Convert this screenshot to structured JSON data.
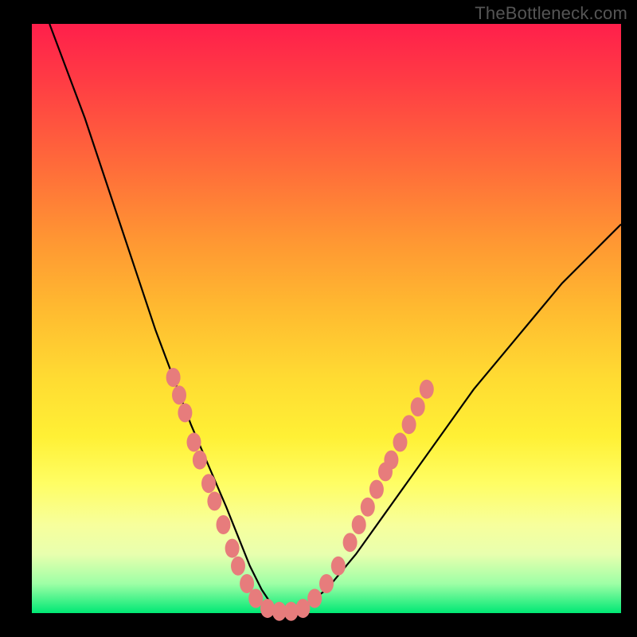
{
  "watermark": "TheBottleneck.com",
  "chart_data": {
    "type": "line",
    "title": "",
    "xlabel": "",
    "ylabel": "",
    "xlim": [
      0,
      100
    ],
    "ylim": [
      0,
      100
    ],
    "series": [
      {
        "name": "bottleneck-curve",
        "x": [
          3,
          6,
          9,
          12,
          15,
          18,
          21,
          24,
          27,
          30,
          33,
          35,
          37,
          39,
          41,
          43,
          46,
          50,
          55,
          60,
          65,
          70,
          75,
          80,
          85,
          90,
          95,
          100
        ],
        "y": [
          100,
          92,
          84,
          75,
          66,
          57,
          48,
          40,
          32,
          25,
          18,
          13,
          8,
          4,
          1,
          0,
          1,
          4,
          10,
          17,
          24,
          31,
          38,
          44,
          50,
          56,
          61,
          66
        ]
      }
    ],
    "markers": {
      "name": "highlight-dots",
      "color": "#e77c7c",
      "points": [
        {
          "x": 24,
          "y": 40
        },
        {
          "x": 25,
          "y": 37
        },
        {
          "x": 26,
          "y": 34
        },
        {
          "x": 27.5,
          "y": 29
        },
        {
          "x": 28.5,
          "y": 26
        },
        {
          "x": 30,
          "y": 22
        },
        {
          "x": 31,
          "y": 19
        },
        {
          "x": 32.5,
          "y": 15
        },
        {
          "x": 34,
          "y": 11
        },
        {
          "x": 35,
          "y": 8
        },
        {
          "x": 36.5,
          "y": 5
        },
        {
          "x": 38,
          "y": 2.5
        },
        {
          "x": 40,
          "y": 0.8
        },
        {
          "x": 42,
          "y": 0.3
        },
        {
          "x": 44,
          "y": 0.3
        },
        {
          "x": 46,
          "y": 0.8
        },
        {
          "x": 48,
          "y": 2.5
        },
        {
          "x": 50,
          "y": 5
        },
        {
          "x": 52,
          "y": 8
        },
        {
          "x": 54,
          "y": 12
        },
        {
          "x": 55.5,
          "y": 15
        },
        {
          "x": 57,
          "y": 18
        },
        {
          "x": 58.5,
          "y": 21
        },
        {
          "x": 60,
          "y": 24
        },
        {
          "x": 61,
          "y": 26
        },
        {
          "x": 62.5,
          "y": 29
        },
        {
          "x": 64,
          "y": 32
        },
        {
          "x": 65.5,
          "y": 35
        },
        {
          "x": 67,
          "y": 38
        }
      ]
    },
    "gradient_stops": [
      {
        "pos": 0.0,
        "color": "#ff1f4b"
      },
      {
        "pos": 0.5,
        "color": "#ffcc33"
      },
      {
        "pos": 0.85,
        "color": "#fffe80"
      },
      {
        "pos": 1.0,
        "color": "#00e874"
      }
    ]
  }
}
